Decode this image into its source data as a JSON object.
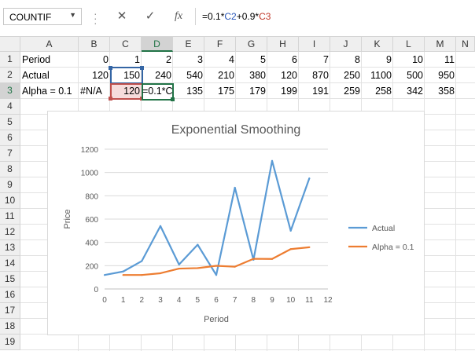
{
  "name_box": {
    "value": "COUNTIF",
    "dropdown_icon": "triangle-down-icon"
  },
  "formula_bar": {
    "cancel_icon": "close-icon",
    "enter_icon": "check-icon",
    "function_icon": "fx-icon",
    "parts": [
      "=0.1*",
      "C2",
      "+0.9*",
      "C3"
    ]
  },
  "columns": [
    "A",
    "B",
    "C",
    "D",
    "E",
    "F",
    "G",
    "H",
    "I",
    "J",
    "K",
    "L",
    "M",
    "N"
  ],
  "selected_column": "D",
  "rows": [
    "1",
    "2",
    "3",
    "4",
    "5",
    "6",
    "7",
    "8",
    "9",
    "10",
    "11",
    "12",
    "13",
    "14",
    "15",
    "16",
    "17",
    "18",
    "19"
  ],
  "selected_row": "3",
  "cells": {
    "row1": {
      "label": "Period",
      "values": [
        "0",
        "1",
        "2",
        "3",
        "4",
        "5",
        "6",
        "7",
        "8",
        "9",
        "10",
        "11"
      ]
    },
    "row2": {
      "label": "Actual",
      "values": [
        "120",
        "150",
        "240",
        "540",
        "210",
        "380",
        "120",
        "870",
        "250",
        "1100",
        "500",
        "950"
      ]
    },
    "row3": {
      "label": "Alpha = 0.1",
      "b": "#N/A",
      "c": "120",
      "d": "=0.1*C",
      "values": [
        "135",
        "175",
        "179",
        "199",
        "191",
        "259",
        "258",
        "342",
        "358"
      ]
    }
  },
  "chart_data": {
    "type": "line",
    "title": "Exponential Smoothing",
    "xlabel": "Period",
    "ylabel": "Price",
    "xlim": [
      0,
      12
    ],
    "ylim": [
      0,
      1200
    ],
    "xticks": [
      "0",
      "1",
      "2",
      "3",
      "4",
      "5",
      "6",
      "7",
      "8",
      "9",
      "10",
      "11",
      "12"
    ],
    "yticks": [
      "0",
      "200",
      "400",
      "600",
      "800",
      "1000",
      "1200"
    ],
    "grid": "horizontal",
    "legend_position": "right",
    "series": [
      {
        "name": "Actual",
        "color": "#5b9bd5",
        "x": [
          0,
          1,
          2,
          3,
          4,
          5,
          6,
          7,
          8,
          9,
          10,
          11
        ],
        "values": [
          120,
          150,
          240,
          540,
          210,
          380,
          120,
          870,
          250,
          1100,
          500,
          950
        ]
      },
      {
        "name": "Alpha = 0.1",
        "color": "#ed7d31",
        "x": [
          1,
          2,
          3,
          4,
          5,
          6,
          7,
          8,
          9,
          10,
          11
        ],
        "values": [
          120,
          120,
          135,
          175,
          179,
          199,
          191,
          259,
          258,
          342,
          358
        ]
      }
    ]
  }
}
